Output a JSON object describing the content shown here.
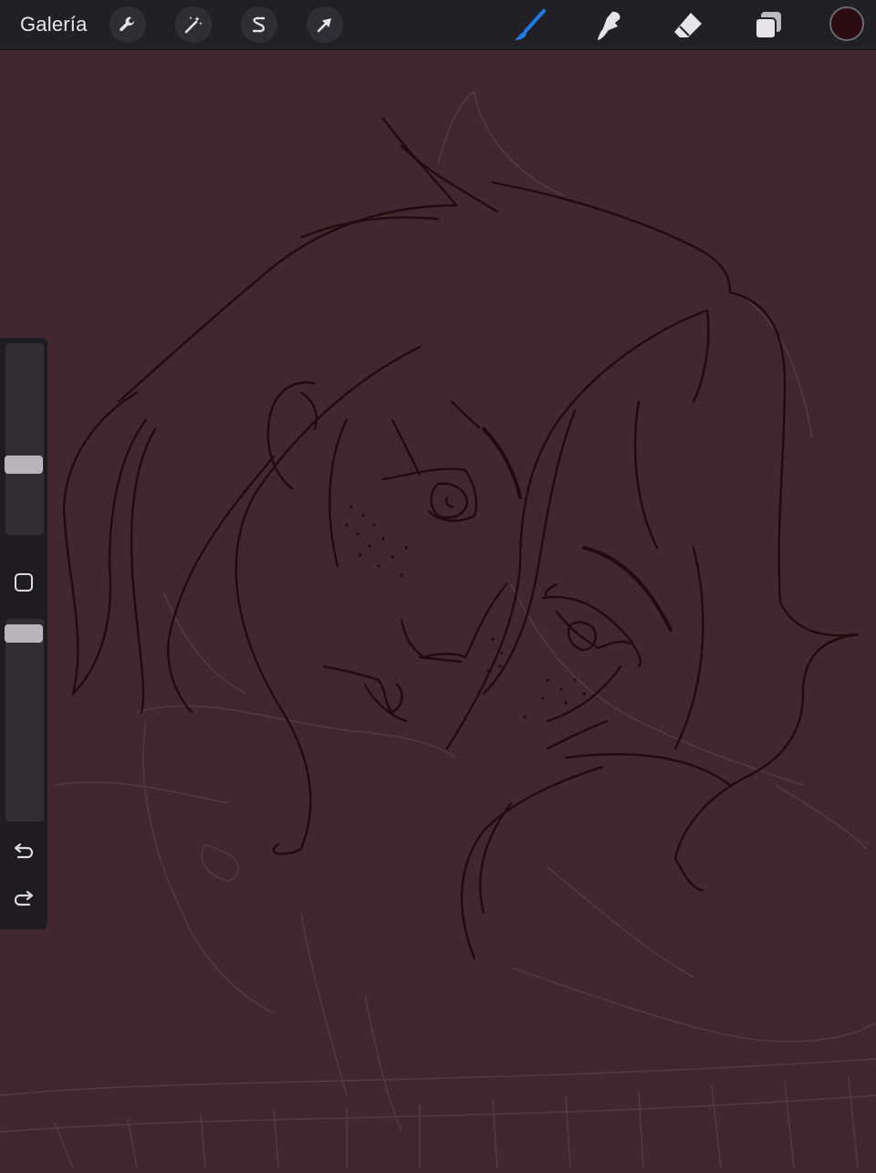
{
  "topbar": {
    "gallery_label": "Galería",
    "actions": [
      {
        "name": "wrench-icon"
      },
      {
        "name": "magic-wand-icon"
      },
      {
        "name": "selection-icon"
      },
      {
        "name": "transform-arrow-icon"
      }
    ],
    "tools": [
      {
        "name": "brush-icon",
        "active": true
      },
      {
        "name": "smudge-icon",
        "active": false
      },
      {
        "name": "eraser-icon",
        "active": false
      },
      {
        "name": "layers-icon",
        "active": false
      }
    ],
    "current_color": "#2b0c10"
  },
  "colors": {
    "canvas_background": "#412830",
    "line_color": "#240a0e",
    "sketch_line_color": "#5c4048",
    "active_tool_color": "#1e7be6",
    "toolbar_background": "#212024"
  },
  "sidebar": {
    "brush_size_level": 0.35,
    "opacity_level": 0.98,
    "buttons": [
      "modify-square-icon",
      "undo-icon",
      "redo-icon"
    ]
  }
}
